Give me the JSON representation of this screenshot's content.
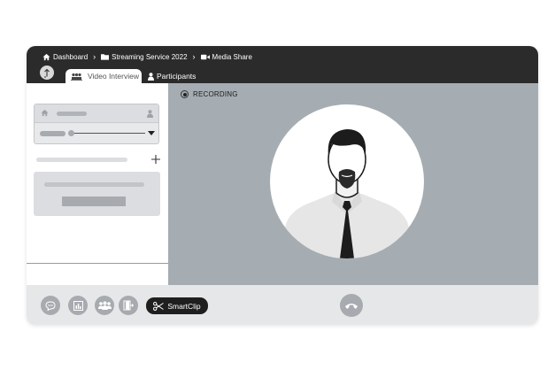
{
  "breadcrumb": [
    {
      "label": "Dashboard",
      "icon": "home-icon"
    },
    {
      "label": "Streaming Service 2022",
      "icon": "folder-icon"
    },
    {
      "label": "Media Share",
      "icon": "video-camera-icon"
    }
  ],
  "header": {
    "back_icon": "upload-arrow-icon"
  },
  "tabs": [
    {
      "label": "Video Interview",
      "icon": "group-icon",
      "active": true
    },
    {
      "label": "Participants",
      "icon": "person-icon",
      "active": false
    }
  ],
  "stage": {
    "recording_label": "RECORDING"
  },
  "toolbar": {
    "buttons": [
      "chat-icon",
      "chart-icon",
      "people-icon",
      "exit-door-icon"
    ],
    "smartclip_label": "SmartClip",
    "end_call_icon": "phone-hangup-icon"
  },
  "colors": {
    "topbar": "#2b2b2b",
    "stage": "#a5adb2",
    "bottombar": "#e6e7e9",
    "control": "#a7aaae",
    "smartclip": "#1f1f1f"
  }
}
